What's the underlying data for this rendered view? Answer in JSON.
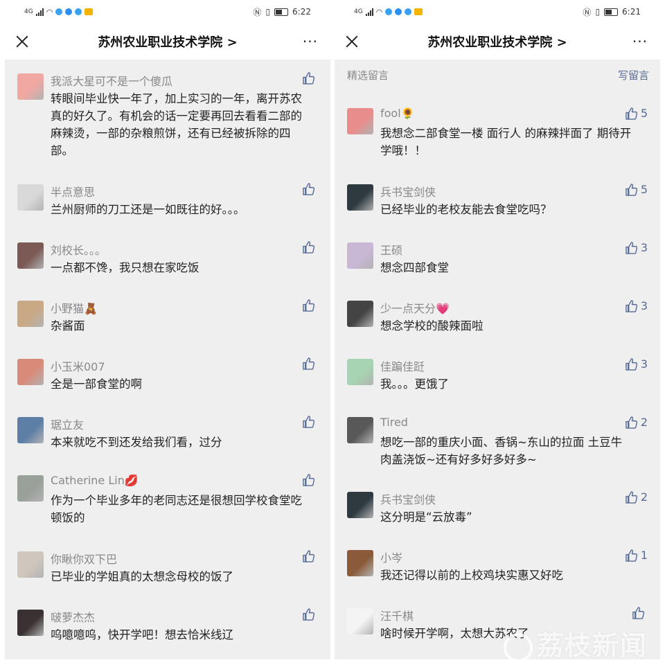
{
  "left": {
    "status": {
      "time": "6:22",
      "carrier": "4G"
    },
    "title": "苏州农业职业技术学院",
    "chevron": ">",
    "more": "···",
    "comments": [
      {
        "name": "我派大星可不是一个傻瓜",
        "text": "转眼间毕业快一年了，加上实习的一年，离开苏农真的好久了。有机会的话一定要再回去看看二部的麻辣烫，一部的杂粮煎饼，还有已经被拆除的四部。",
        "likes": "",
        "avatar_color": "#f1a7a2"
      },
      {
        "name": "半点意思",
        "text": "兰州厨师的刀工还是一如既往的好。。。",
        "likes": "",
        "avatar_color": "#d9d9d9"
      },
      {
        "name": "刘校长。。。",
        "text": "一点都不馋，我只想在家吃饭",
        "likes": "",
        "avatar_color": "#7b5a56"
      },
      {
        "name": "小野猫🧸",
        "text": "杂酱面",
        "likes": "",
        "avatar_color": "#c9a985"
      },
      {
        "name": "小玉米007",
        "text": "全是一部食堂的啊",
        "likes": "",
        "avatar_color": "#d98b7a"
      },
      {
        "name": "琚立友",
        "text": "本来就吃不到还发给我们看，过分",
        "likes": "",
        "avatar_color": "#5d7fa6"
      },
      {
        "name": "Catherine Lin💋",
        "text": "作为一个毕业多年的老同志还是很想回学校食堂吃顿饭的",
        "likes": "",
        "avatar_color": "#9aa09a"
      },
      {
        "name": "你瞅你双下巴",
        "text": "已毕业的学姐真的太想念母校的饭了",
        "likes": "",
        "avatar_color": "#cfc6bd"
      },
      {
        "name": "啵萝杰杰",
        "text": "呜噫噫呜，快开学吧！想去恰米线辽",
        "likes": "",
        "avatar_color": "#3a3232"
      }
    ]
  },
  "right": {
    "status": {
      "time": "6:21",
      "carrier": "4G"
    },
    "title": "苏州农业职业技术学院",
    "chevron": ">",
    "more": "···",
    "section_title": "精选留言",
    "write_label": "写留言",
    "comments": [
      {
        "name": "fool🌻",
        "text": "我想念二部食堂一楼 面行人 的麻辣拌面了 期待开学哦！！",
        "likes": "5",
        "avatar_color": "#e98c8c"
      },
      {
        "name": "兵书宝剑侠",
        "text": "已经毕业的老校友能去食堂吃吗？",
        "likes": "5",
        "avatar_color": "#2f3a40"
      },
      {
        "name": "王硕",
        "text": "想念四部食堂",
        "likes": "3",
        "avatar_color": "#c9b7d6"
      },
      {
        "name": "少一点天分💗",
        "text": "想念学校的酸辣面啦",
        "likes": "3",
        "avatar_color": "#444444"
      },
      {
        "name": "佳蹁佳跹",
        "text": "我。。。更饿了",
        "likes": "3",
        "avatar_color": "#a7d4b2"
      },
      {
        "name": "Tired",
        "text": "想吃一部的重庆小面、香锅~东山的拉面 土豆牛肉盖浇饭~还有好多好多好多~",
        "likes": "2",
        "avatar_color": "#585858"
      },
      {
        "name": "兵书宝剑侠",
        "text": "这分明是“云放毒”",
        "likes": "2",
        "avatar_color": "#2f3a40"
      },
      {
        "name": "小岑",
        "text": "我还记得以前的上校鸡块实惠又好吃",
        "likes": "1",
        "avatar_color": "#8a5a3a"
      },
      {
        "name": "汪千棋",
        "text": "啥时候开学啊，太想大苏农了",
        "likes": "",
        "avatar_color": "#f4f4f4"
      }
    ],
    "watermark": "荔枝新闻"
  }
}
